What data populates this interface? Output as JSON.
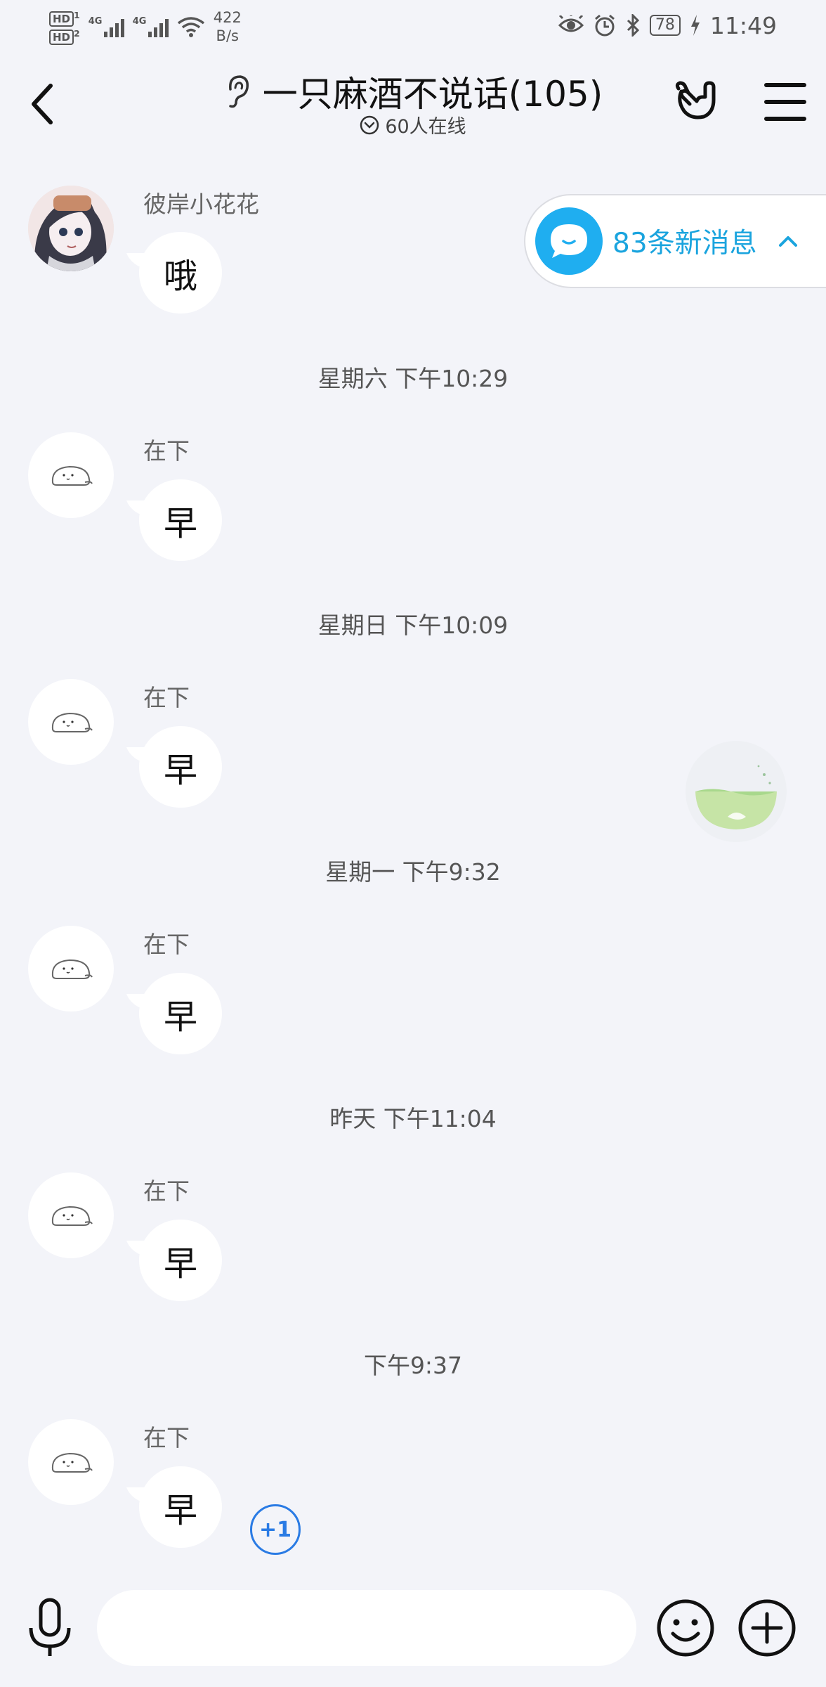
{
  "status_bar": {
    "hd1": "HD",
    "hd1_sub": "1",
    "hd2": "HD",
    "hd2_sub": "2",
    "net1": "4G",
    "net2": "4G",
    "speed_value": "422",
    "speed_unit": "B/s",
    "battery": "78",
    "time": "11:49"
  },
  "header": {
    "title": "一只麻酒不说话(105)",
    "online": "60人在线"
  },
  "new_messages": {
    "label": "83条新消息"
  },
  "messages": [
    {
      "sender": "彼岸小花花",
      "text": "哦"
    },
    {
      "timestamp": "星期六 下午10:29",
      "sender": "在下",
      "text": "早"
    },
    {
      "timestamp": "星期日 下午10:09",
      "sender": "在下",
      "text": "早"
    },
    {
      "timestamp": "星期一 下午9:32",
      "sender": "在下",
      "text": "早"
    },
    {
      "timestamp": "昨天 下午11:04",
      "sender": "在下",
      "text": "早"
    },
    {
      "timestamp": "下午9:37",
      "sender": "在下",
      "text": "早"
    }
  ],
  "plus_one": "+1",
  "input": {
    "placeholder": "",
    "value": ""
  },
  "colors": {
    "background": "#f3f4f9",
    "accent": "#1aa4de",
    "plus_one": "#2a7be4"
  },
  "icons": [
    "back-arrow-icon",
    "ear-icon",
    "hand-gesture-icon",
    "menu-icon",
    "chat-bubble-icon",
    "chevron-up-icon",
    "microphone-icon",
    "emoji-icon",
    "plus-circle-icon"
  ]
}
